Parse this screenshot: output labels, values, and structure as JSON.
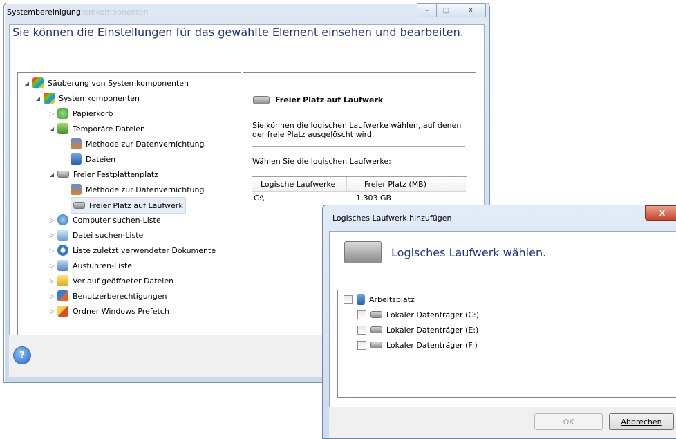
{
  "window": {
    "title": "Systembereinigung",
    "title_ghost": "temkomponenten",
    "heading": "Sie können die Einstellungen für das gewählte Element einsehen und bearbeiten.",
    "caption_buttons": {
      "minimize": "–",
      "maximize": "□",
      "close": "X"
    }
  },
  "tree": {
    "items": [
      {
        "label": "Säuberung von Systemkomponenten",
        "level": 0,
        "state": "expanded",
        "icon": "windows-flag-icon"
      },
      {
        "label": "Systemkomponenten",
        "level": 1,
        "state": "expanded",
        "icon": "windows-flag-icon"
      },
      {
        "label": "Papierkorb",
        "level": 2,
        "state": "collapsed",
        "icon": "recycle-bin-icon"
      },
      {
        "label": "Temporäre Dateien",
        "level": 2,
        "state": "expanded",
        "icon": "temp-files-icon"
      },
      {
        "label": "Methode zur Datenvernichtung",
        "level": 3,
        "state": "leaf",
        "icon": "calendar-method-icon"
      },
      {
        "label": "Dateien",
        "level": 3,
        "state": "leaf",
        "icon": "files-icon"
      },
      {
        "label": "Freier Festplattenplatz",
        "level": 2,
        "state": "expanded",
        "icon": "drive-icon"
      },
      {
        "label": "Methode zur Datenvernichtung",
        "level": 3,
        "state": "leaf",
        "icon": "calendar-method-icon"
      },
      {
        "label": "Freier Platz auf Laufwerk",
        "level": 3,
        "state": "selected",
        "icon": "drive-icon"
      },
      {
        "label": "Computer suchen-Liste",
        "level": 2,
        "state": "collapsed",
        "icon": "computer-search-icon"
      },
      {
        "label": "Datei suchen-Liste",
        "level": 2,
        "state": "collapsed",
        "icon": "file-search-icon"
      },
      {
        "label": "Liste zuletzt verwendeter Dokumente",
        "level": 2,
        "state": "collapsed",
        "icon": "recent-docs-icon"
      },
      {
        "label": "Ausführen-Liste",
        "level": 2,
        "state": "collapsed",
        "icon": "run-icon"
      },
      {
        "label": "Verlauf geöffneter Dateien",
        "level": 2,
        "state": "collapsed",
        "icon": "folder-history-icon"
      },
      {
        "label": "Benutzerberechtigungen",
        "level": 2,
        "state": "collapsed",
        "icon": "user-permissions-icon"
      },
      {
        "label": "Ordner Windows Prefetch",
        "level": 2,
        "state": "collapsed",
        "icon": "prefetch-folder-icon"
      }
    ]
  },
  "right_panel": {
    "title": "Freier Platz auf Laufwerk",
    "description": "Sie können die logischen Laufwerke wählen, auf denen der freie Platz ausgelöscht wird.",
    "select_label": "Wählen Sie die logischen Laufwerke:",
    "table": {
      "columns": [
        "Logische Laufwerke",
        "Freier Platz (MB)"
      ],
      "rows": [
        [
          "C:\\",
          "1,303 GB"
        ]
      ]
    }
  },
  "dialog": {
    "title": "Logisches Laufwerk hinzufügen",
    "close": "X",
    "heading": "Logisches Laufwerk wählen.",
    "root": "Arbeitsplatz",
    "drives": [
      "Lokaler Datenträger (C:)",
      "Lokaler Datenträger (E:)",
      "Lokaler Datenträger (F:)"
    ],
    "ok_label": "OK",
    "cancel_label": "Abbrechen"
  },
  "colors": {
    "heading": "#1e3287",
    "selection": "#e8eef7"
  }
}
